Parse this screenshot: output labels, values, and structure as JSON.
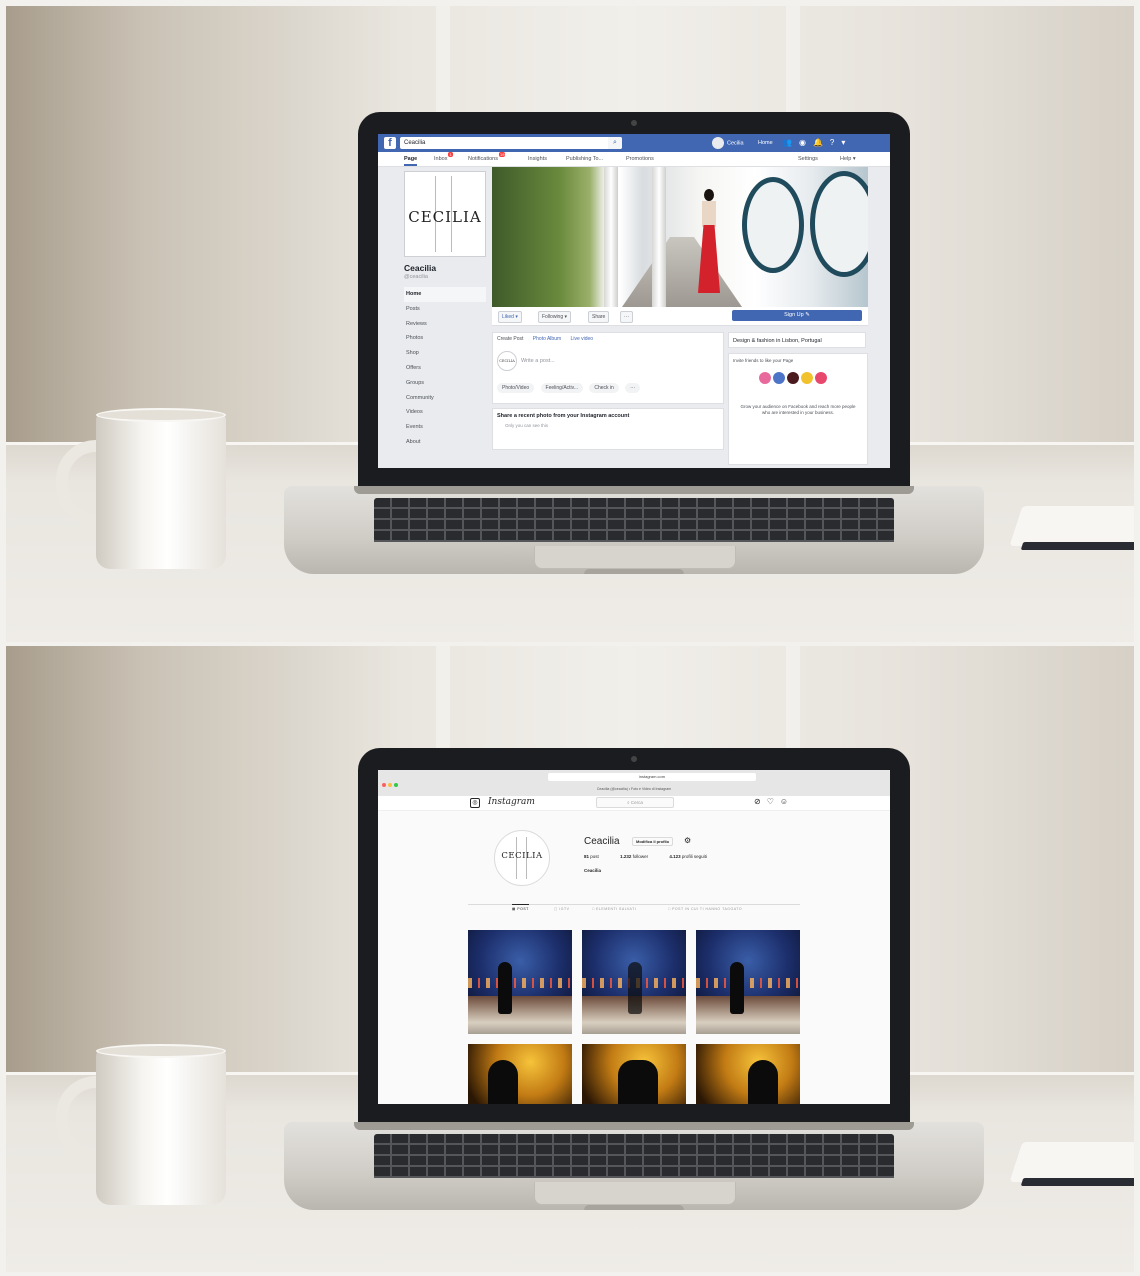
{
  "facebook": {
    "search_value": "Ceacilia",
    "user_name": "Cecilia",
    "home_label": "Home",
    "page_tabs": [
      "Page",
      "Inbox",
      "Notifications",
      "Insights",
      "Publishing To...",
      "Promotions"
    ],
    "inbox_badge": "1",
    "notifications_badge": "19",
    "right_tabs": [
      "Settings",
      "Help ▾"
    ],
    "page_name": "Ceacilia",
    "page_handle": "@ceacilia",
    "logo_text": "CECILIA",
    "menu": [
      "Home",
      "Posts",
      "Reviews",
      "Photos",
      "Shop",
      "Offers",
      "Groups",
      "Community",
      "Videos",
      "Events",
      "About"
    ],
    "actions": [
      "Liked ▾",
      "Following ▾",
      "Share",
      "···"
    ],
    "signup_label": "Sign Up ✎",
    "composer": {
      "tabs": [
        "Create Post",
        "Photo Album",
        "Live video"
      ],
      "placeholder": "Write a post...",
      "buttons": [
        "Photo/Video",
        "Feeling/Activ...",
        "Check in",
        "···"
      ]
    },
    "instagram_card": {
      "title": "Share a recent photo from your Instagram account",
      "subtitle": "Only you can see this"
    },
    "about": "Design & fashion in Lisbon, Portugal",
    "invite_title": "Invite friends to like your Page",
    "invite_colors": [
      "#e86a9d",
      "#4e74c8",
      "#4a1a1e",
      "#f2c22e",
      "#e8486c"
    ],
    "grow_text": "Grow your audience on Facebook and reach more people who are interested in your business."
  },
  "instagram": {
    "url": "instagram.com",
    "tab_title": "Ceacilia (@ceacilia) • Foto e Video di Instagram",
    "wordmark": "Instagram",
    "search_placeholder": "⌕ Cerca",
    "logo_text": "CECILIA",
    "username": "Ceacilia",
    "edit_label": "Modifica il profilo",
    "stats": [
      {
        "value": "81",
        "label": "post"
      },
      {
        "value": "1.232",
        "label": "follower"
      },
      {
        "value": "4.123",
        "label": "profili seguiti"
      }
    ],
    "full_name": "Ceacilia",
    "tabs": [
      "▦ POST",
      "▢ IGTV",
      "□ ELEMENTI SALVATI",
      "□ POST IN CUI TI HANNO TAGGATO"
    ]
  }
}
